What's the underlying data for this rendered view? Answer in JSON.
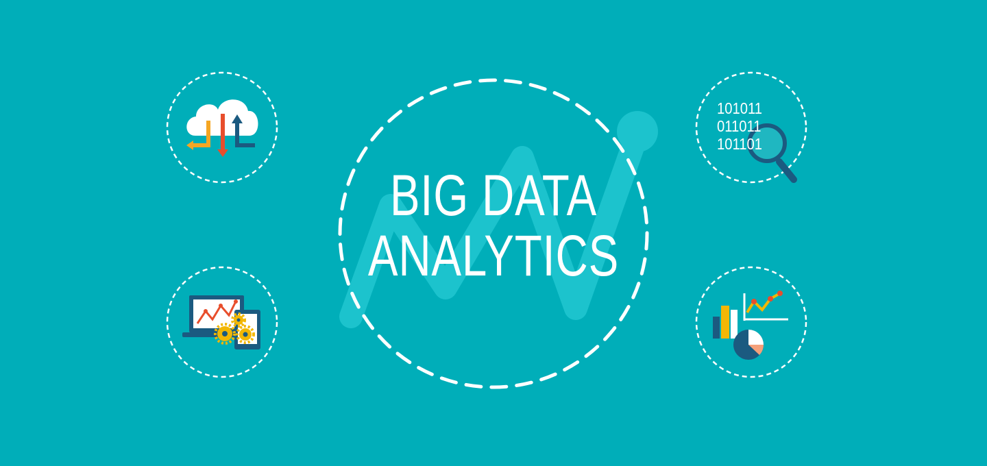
{
  "banner": {
    "title_line_1": "BIG DATA",
    "title_line_2": "ANALYTICS",
    "background_color": "#00AEB9"
  },
  "icons": {
    "top_left": "cloud-transfer-icon",
    "bottom_left": "devices-gears-icon",
    "top_right": "binary-search-icon",
    "bottom_right": "charts-analytics-icon"
  },
  "binary_code": {
    "line_1": "101011",
    "line_2": "011011",
    "line_3": "101101"
  },
  "colors": {
    "orange": "#F5A623",
    "red": "#E84E2C",
    "navy": "#1B5A80",
    "yellow": "#F2B705",
    "white": "#FFFFFF"
  }
}
